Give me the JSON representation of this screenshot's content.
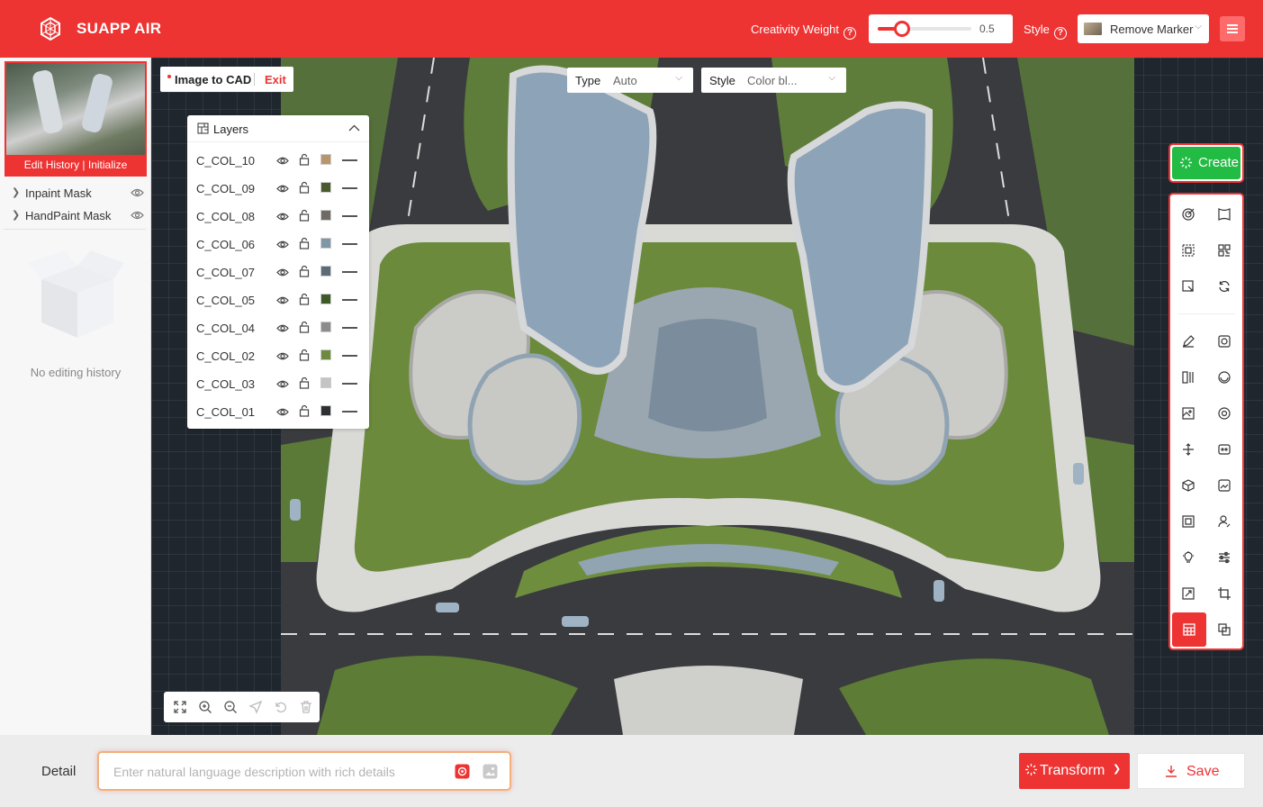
{
  "header": {
    "app_title": "SUAPP AIR",
    "creativity_label": "Creativity Weight",
    "creativity_value": "0.5",
    "creativity_fraction": 0.5,
    "style_label": "Style",
    "style_value": "Remove Marker"
  },
  "left_panel": {
    "thumb_caption": "Edit History | Initialize",
    "masks": [
      {
        "label": "Inpaint Mask"
      },
      {
        "label": "HandPaint Mask"
      }
    ],
    "empty_text": "No editing history"
  },
  "canvas": {
    "mode_label": "Image to CAD",
    "exit_label": "Exit",
    "type_label": "Type",
    "type_value": "Auto",
    "style_label": "Style",
    "style_value": "Color bl..."
  },
  "layers": {
    "title": "Layers",
    "items": [
      {
        "name": "C_COL_10",
        "color": "#b8956a"
      },
      {
        "name": "C_COL_09",
        "color": "#4a5a2e"
      },
      {
        "name": "C_COL_08",
        "color": "#6f6b63"
      },
      {
        "name": "C_COL_06",
        "color": "#8097a8"
      },
      {
        "name": "C_COL_07",
        "color": "#5a6c78"
      },
      {
        "name": "C_COL_05",
        "color": "#3e5a28"
      },
      {
        "name": "C_COL_04",
        "color": "#8c8c8c"
      },
      {
        "name": "C_COL_02",
        "color": "#6e8a3e"
      },
      {
        "name": "C_COL_03",
        "color": "#c4c4c2"
      },
      {
        "name": "C_COL_01",
        "color": "#2e2f32"
      }
    ]
  },
  "right_toolbar": {
    "create_label": "Create"
  },
  "bottom": {
    "detail_label": "Detail",
    "detail_placeholder": "Enter natural language description with rich details",
    "transform_label": "Transform",
    "save_label": "Save"
  },
  "colors": {
    "brand": "#ee3333",
    "create": "#22bb44",
    "canvas_bg": "#1f262d"
  }
}
